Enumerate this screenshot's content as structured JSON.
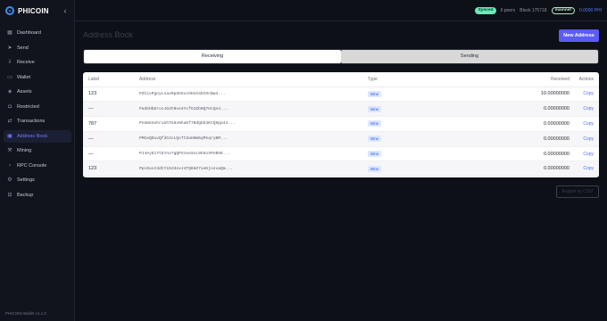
{
  "brand": {
    "name": "PHICOIN"
  },
  "sidebar": {
    "items": [
      {
        "label": "Dashboard",
        "icon": "grid-icon"
      },
      {
        "label": "Send",
        "icon": "send-icon"
      },
      {
        "label": "Receive",
        "icon": "receive-icon"
      },
      {
        "label": "Wallet",
        "icon": "wallet-icon"
      },
      {
        "label": "Assets",
        "icon": "assets-icon"
      },
      {
        "label": "Restricted",
        "icon": "lock-icon"
      },
      {
        "label": "Transactions",
        "icon": "transactions-icon"
      },
      {
        "label": "Address Book",
        "icon": "book-icon"
      },
      {
        "label": "Mining",
        "icon": "pickaxe-icon"
      },
      {
        "label": "RPC Console",
        "icon": "terminal-icon"
      },
      {
        "label": "Settings",
        "icon": "gear-icon"
      },
      {
        "label": "Backup",
        "icon": "backup-icon"
      }
    ],
    "active_index": 7,
    "version": "PHICOIN Wallet v1.1.0"
  },
  "topbar": {
    "sync": "Synced",
    "peers": "0 peers",
    "block": "Block 175718",
    "network": "mainnet",
    "price": "0.0000 PHI"
  },
  "page": {
    "title": "Address Book",
    "new_button": "New Address",
    "export_button": "Export to CSV"
  },
  "tabs": [
    {
      "label": "Receiving",
      "active": true
    },
    {
      "label": "Sending",
      "active": false
    }
  ],
  "table": {
    "headers": {
      "label": "Label",
      "address": "Address",
      "type": "Type",
      "received": "Received",
      "actions": "Actions"
    },
    "rows": [
      {
        "label": "123",
        "address": "PZCivPgnyLsaxRp5GGvcOHnk4bCOcBw4...",
        "type": "Mine",
        "received": "10.00000000",
        "action": "Copy"
      },
      {
        "label": "—",
        "address": "PaSbHbDrooJGdtBse4YcfG3Zb0Q7HcQe4...",
        "type": "Mine",
        "received": "0.00000000",
        "action": "Copy"
      },
      {
        "label": "787",
        "address": "PnSmGXehruGhTG6vNhaKf7BdQGb3KtQ9pp44...",
        "type": "Mine",
        "received": "0.00000000",
        "action": "Copy"
      },
      {
        "label": "—",
        "address": "PMCeQDuvQfdCAcLQsTtZaH6W5qPkqryBM...",
        "type": "Mine",
        "received": "0.00000000",
        "action": "Copy"
      },
      {
        "label": "—",
        "address": "PJ4eyE17tEYnv7gQPXzeeSoL9kKoVPnBVE...",
        "type": "Mine",
        "received": "0.00000000",
        "action": "Copy"
      },
      {
        "label": "123",
        "address": "Ppc6uoz3dCY1533ovJ4TQ6HZ7xeKjosvaQm...",
        "type": "Mine",
        "received": "0.00000000",
        "action": "Copy"
      }
    ]
  },
  "colors": {
    "accent": "#5b5bf7",
    "sync": "#6ee7b7",
    "price": "#4f7cff"
  }
}
